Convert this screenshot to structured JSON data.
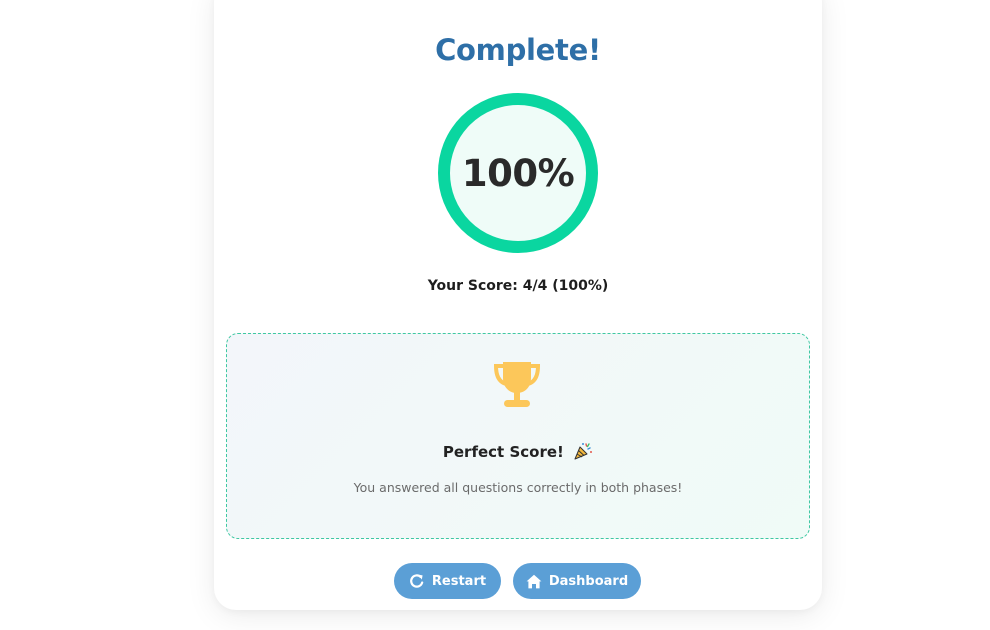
{
  "result": {
    "title": "Complete!",
    "percent_label": "100%",
    "score_line": "Your Score: 4/4 (100%)"
  },
  "banner": {
    "icon": "trophy-icon",
    "heading": "Perfect Score!",
    "heading_emoji": "party-popper-icon",
    "message": "You answered all questions correctly in both phases!"
  },
  "actions": {
    "restart_label": "Restart",
    "restart_icon": "restart-icon",
    "dashboard_label": "Dashboard",
    "dashboard_icon": "home-icon"
  },
  "colors": {
    "title": "#2e6fa7",
    "ring": "#0ad6a0",
    "trophy": "#fcc75a",
    "button": "#5b9fd6"
  }
}
